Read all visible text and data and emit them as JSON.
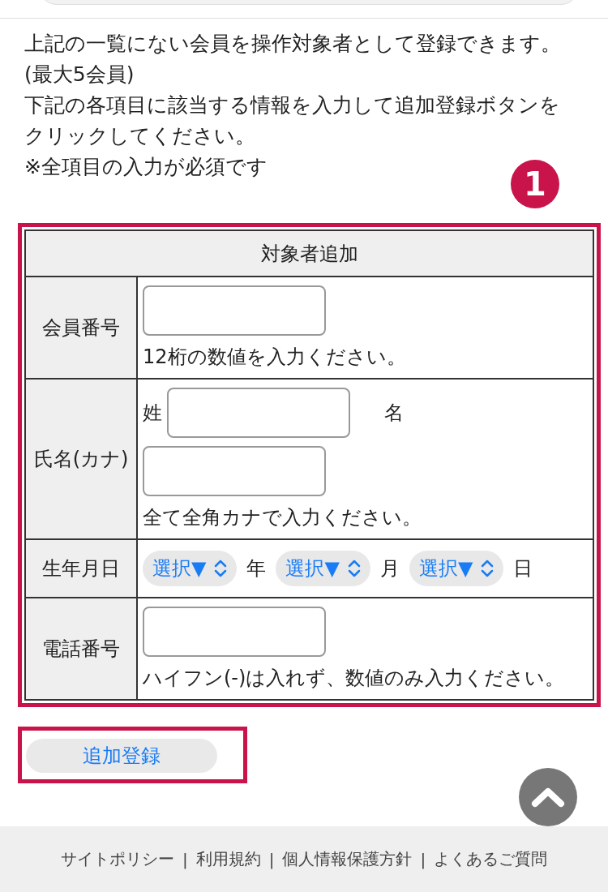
{
  "intro": [
    "上記の一覧にない会員を操作対象者として登録できます。",
    "(最大5会員)",
    "下記の各項目に該当する情報を入力して追加登録ボタンをクリックしてください。",
    "※全項目の入力が必須です"
  ],
  "annotation": {
    "number": "1"
  },
  "form": {
    "title": "対象者追加",
    "rows": [
      {
        "kind": "member",
        "label": "会員番号",
        "hint": "12桁の数値を入力ください。"
      },
      {
        "kind": "name",
        "label": "氏名(カナ)",
        "family_label": "姓",
        "given_label": "名",
        "hint": "全て全角カナで入力ください。"
      },
      {
        "kind": "date",
        "label": "生年月日",
        "selects": [
          {
            "value": "選択▼",
            "unit": "年"
          },
          {
            "value": "選択▼",
            "unit": "月"
          },
          {
            "value": "選択▼",
            "unit": "日"
          }
        ]
      },
      {
        "kind": "member",
        "label": "電話番号",
        "hint": "ハイフン(-)は入れず、数値のみ入力ください。"
      }
    ]
  },
  "submit_button": "追加登録",
  "footer": {
    "separator": "|",
    "links": [
      "サイトポリシー",
      "利用規約",
      "個人情報保護方針",
      "よくあるご質問"
    ]
  }
}
